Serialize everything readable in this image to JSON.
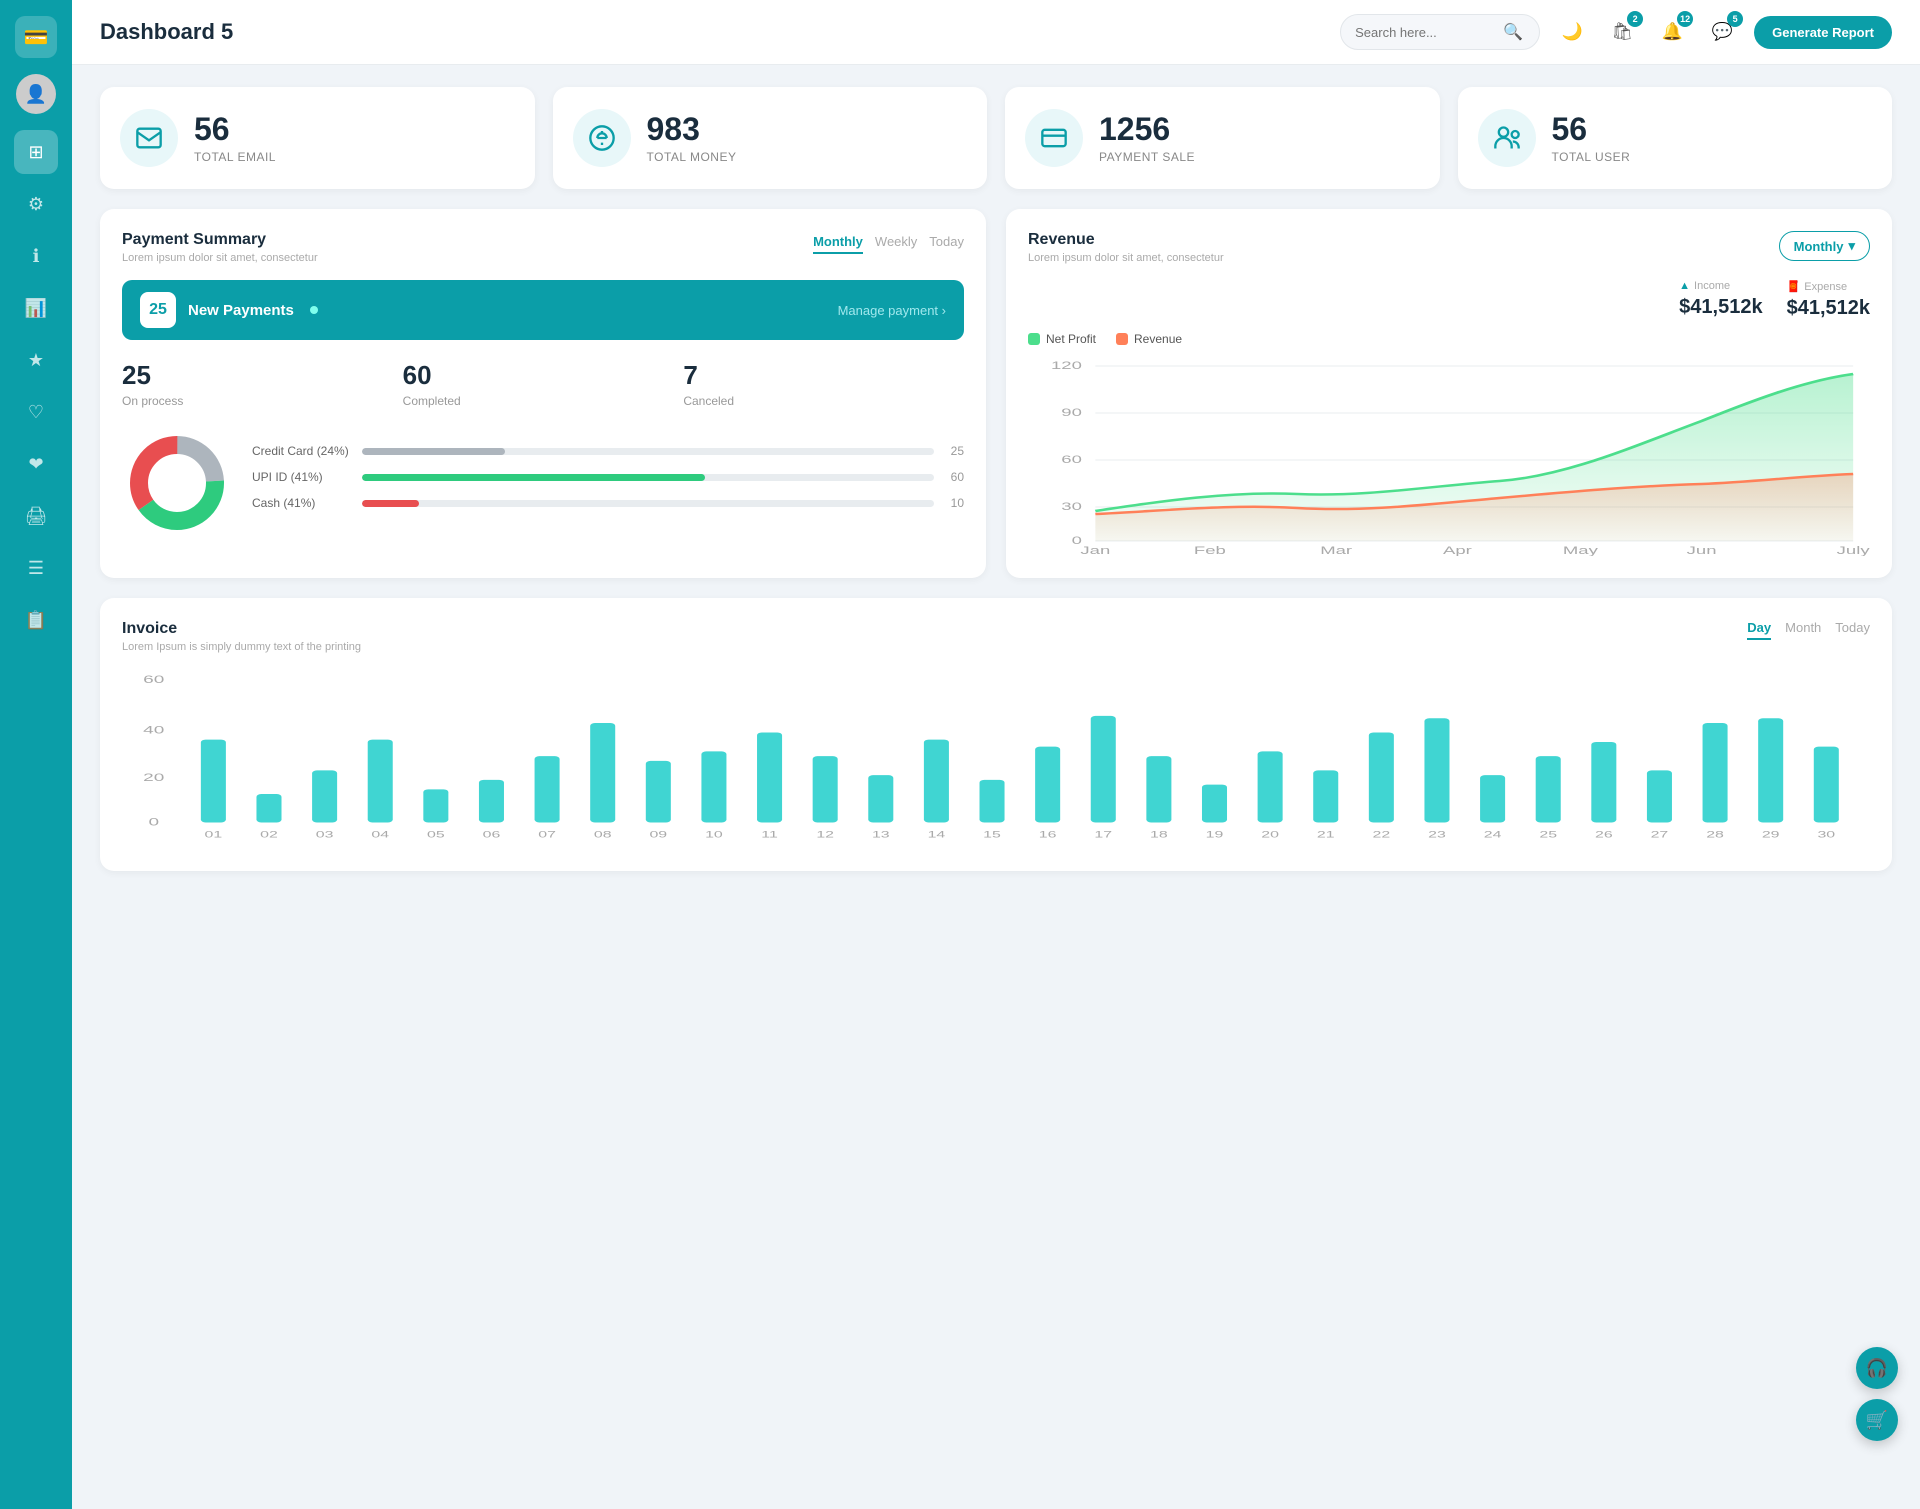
{
  "sidebar": {
    "logo_icon": "💳",
    "items": [
      {
        "id": "avatar",
        "icon": "👤",
        "active": false
      },
      {
        "id": "dashboard",
        "icon": "⊞",
        "active": true
      },
      {
        "id": "settings",
        "icon": "⚙",
        "active": false
      },
      {
        "id": "info",
        "icon": "ℹ",
        "active": false
      },
      {
        "id": "analytics",
        "icon": "📊",
        "active": false
      },
      {
        "id": "star",
        "icon": "★",
        "active": false
      },
      {
        "id": "heart",
        "icon": "♡",
        "active": false
      },
      {
        "id": "heart2",
        "icon": "❤",
        "active": false
      },
      {
        "id": "print",
        "icon": "🖨",
        "active": false
      },
      {
        "id": "list",
        "icon": "☰",
        "active": false
      },
      {
        "id": "doc",
        "icon": "📋",
        "active": false
      }
    ]
  },
  "header": {
    "title": "Dashboard 5",
    "search_placeholder": "Search here...",
    "icon_badges": {
      "cart": 2,
      "bell": 12,
      "chat": 5
    },
    "generate_btn": "Generate Report"
  },
  "stats": [
    {
      "id": "total-email",
      "icon": "📋",
      "number": "56",
      "label": "TOTAL EMAIL"
    },
    {
      "id": "total-money",
      "icon": "$",
      "number": "983",
      "label": "TOTAL MONEY"
    },
    {
      "id": "payment-sale",
      "icon": "💳",
      "number": "1256",
      "label": "PAYMENT SALE"
    },
    {
      "id": "total-user",
      "icon": "👥",
      "number": "56",
      "label": "TOTAL USER"
    }
  ],
  "payment_summary": {
    "title": "Payment Summary",
    "subtitle": "Lorem ipsum dolor sit amet, consectetur",
    "tabs": [
      "Monthly",
      "Weekly",
      "Today"
    ],
    "active_tab": "Monthly",
    "new_payments_count": "25",
    "new_payments_label": "New Payments",
    "manage_link": "Manage payment",
    "stats": [
      {
        "number": "25",
        "label": "On process"
      },
      {
        "number": "60",
        "label": "Completed"
      },
      {
        "number": "7",
        "label": "Canceled"
      }
    ],
    "bars": [
      {
        "label": "Credit Card (24%)",
        "value": 25,
        "max": 100,
        "color": "#adb5bd",
        "display": "25"
      },
      {
        "label": "UPI ID (41%)",
        "value": 60,
        "max": 100,
        "color": "#2ecb7e",
        "display": "60"
      },
      {
        "label": "Cash (41%)",
        "value": 10,
        "max": 100,
        "color": "#e84e50",
        "display": "10"
      }
    ],
    "donut": {
      "segments": [
        {
          "label": "Credit Card",
          "value": 24,
          "color": "#adb5bd"
        },
        {
          "label": "UPI ID",
          "value": 41,
          "color": "#2ecb7e"
        },
        {
          "label": "Cash",
          "value": 35,
          "color": "#e84e50"
        }
      ]
    }
  },
  "revenue": {
    "title": "Revenue",
    "subtitle": "Lorem ipsum dolor sit amet, consectetur",
    "active_tab": "Monthly",
    "income": {
      "label": "Income",
      "value": "$41,512k"
    },
    "expense": {
      "label": "Expense",
      "value": "$41,512k"
    },
    "legend": [
      {
        "label": "Net Profit",
        "color": "#4cde8c"
      },
      {
        "label": "Revenue",
        "color": "#ff8059"
      }
    ],
    "x_labels": [
      "Jan",
      "Feb",
      "Mar",
      "Apr",
      "May",
      "Jun",
      "July"
    ],
    "y_labels": [
      "0",
      "30",
      "60",
      "90",
      "120"
    ]
  },
  "invoice": {
    "title": "Invoice",
    "subtitle": "Lorem Ipsum is simply dummy text of the printing",
    "tabs": [
      "Day",
      "Month",
      "Today"
    ],
    "active_tab": "Day",
    "y_labels": [
      "0",
      "20",
      "40",
      "60"
    ],
    "x_labels": [
      "01",
      "02",
      "03",
      "04",
      "05",
      "06",
      "07",
      "08",
      "09",
      "10",
      "11",
      "12",
      "13",
      "14",
      "15",
      "16",
      "17",
      "18",
      "19",
      "20",
      "21",
      "22",
      "23",
      "24",
      "25",
      "26",
      "27",
      "28",
      "29",
      "30"
    ],
    "bar_values": [
      35,
      12,
      22,
      35,
      14,
      18,
      28,
      42,
      26,
      30,
      38,
      28,
      20,
      35,
      18,
      32,
      45,
      28,
      16,
      30,
      22,
      38,
      44,
      20,
      28,
      34,
      22,
      42,
      44,
      32
    ]
  },
  "fab": {
    "support": "🎧",
    "cart": "🛒"
  }
}
